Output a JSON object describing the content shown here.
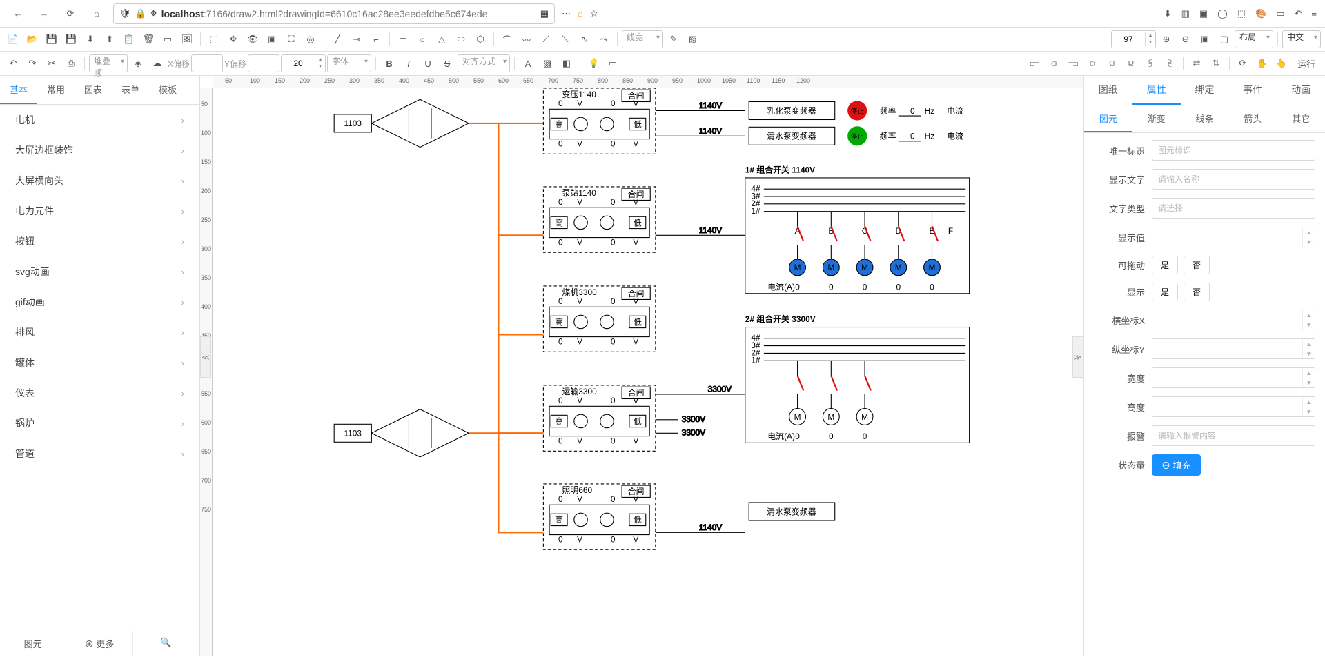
{
  "browser": {
    "url_host": "localhost",
    "url_path": ":7166/draw2.html?drawingId=6610c16ac28ee3eedefdbe5c674ede"
  },
  "toolbar_row1": {
    "line_width_placeholder": "线宽",
    "zoom_value": "97",
    "layout_label": "布局",
    "lang_label": "中文"
  },
  "toolbar_row2": {
    "stack_placeholder": "堆叠顺",
    "x_offset_label": "X偏移",
    "y_offset_label": "Y偏移",
    "font_size": "20",
    "font_placeholder": "字体",
    "align_placeholder": "对齐方式",
    "run_label": "运行"
  },
  "left_tabs": [
    "基本",
    "常用",
    "图表",
    "表单",
    "模板"
  ],
  "shape_categories": [
    "电机",
    "大屏边框装饰",
    "大屏横向头",
    "电力元件",
    "按钮",
    "svg动画",
    "gif动画",
    "排风",
    "罐体",
    "仪表",
    "锅炉",
    "管道"
  ],
  "left_bottom": {
    "p1": "图元",
    "p2": "⊕ 更多",
    "p3_icon": "search"
  },
  "right_tabs": [
    "图纸",
    "属性",
    "绑定",
    "事件",
    "动画"
  ],
  "right_subtabs": [
    "图元",
    "渐变",
    "线条",
    "箭头",
    "其它"
  ],
  "props": {
    "labels": {
      "uid": "唯一标识",
      "text": "显示文字",
      "textType": "文字类型",
      "value": "显示值",
      "draggable": "可拖动",
      "display": "显示",
      "x": "横坐标X",
      "y": "纵坐标Y",
      "w": "宽度",
      "h": "高度",
      "alarm": "报警",
      "state": "状态量"
    },
    "placeholders": {
      "uid": "图元标识",
      "text": "请输入名称",
      "textType": "请选择",
      "alarm": "请输入报警内容"
    },
    "yes": "是",
    "no": "否",
    "fill_btn": "⊕ 填充"
  },
  "diagram": {
    "node_1103a": "1103",
    "node_1103b": "1103",
    "box_labels": {
      "high": "高",
      "low": "低",
      "close": "合闸"
    },
    "box1_title": "变压1140",
    "box2_title": "泵站1140",
    "box3_title": "煤机3300",
    "box4_title": "运输3300",
    "box5_title": "照明660",
    "emul_pump": "乳化泵变频器",
    "water_pump": "清水泵变频器",
    "freq": "频率",
    "hz": "Hz",
    "freq_val": "0",
    "current": "电流",
    "stop": "停止",
    "combo1": "1# 组合开关 1140V",
    "combo2": "2# 组合开关 3300V",
    "lanes": [
      "4#",
      "3#",
      "2#",
      "1#"
    ],
    "letters": [
      "A",
      "B",
      "C",
      "D",
      "E",
      "F"
    ],
    "amps": "电流(A)",
    "zeros": [
      "0",
      "0",
      "0",
      "0",
      "0"
    ],
    "zeros3": [
      "0",
      "0",
      "0"
    ],
    "v1140": "1140V",
    "v3300": "3300V",
    "volt_row": [
      "0",
      "V",
      "0",
      "V"
    ]
  },
  "ruler_h": [
    "50",
    "100",
    "150",
    "200",
    "250",
    "300",
    "350",
    "400",
    "450",
    "500",
    "550",
    "600",
    "650",
    "700",
    "750",
    "800",
    "850",
    "900",
    "950",
    "1000",
    "1050",
    "1100",
    "1150",
    "1200"
  ],
  "ruler_v": [
    "50",
    "100",
    "150",
    "200",
    "250",
    "300",
    "350",
    "400",
    "450",
    "500",
    "550",
    "600",
    "650",
    "700",
    "750"
  ]
}
